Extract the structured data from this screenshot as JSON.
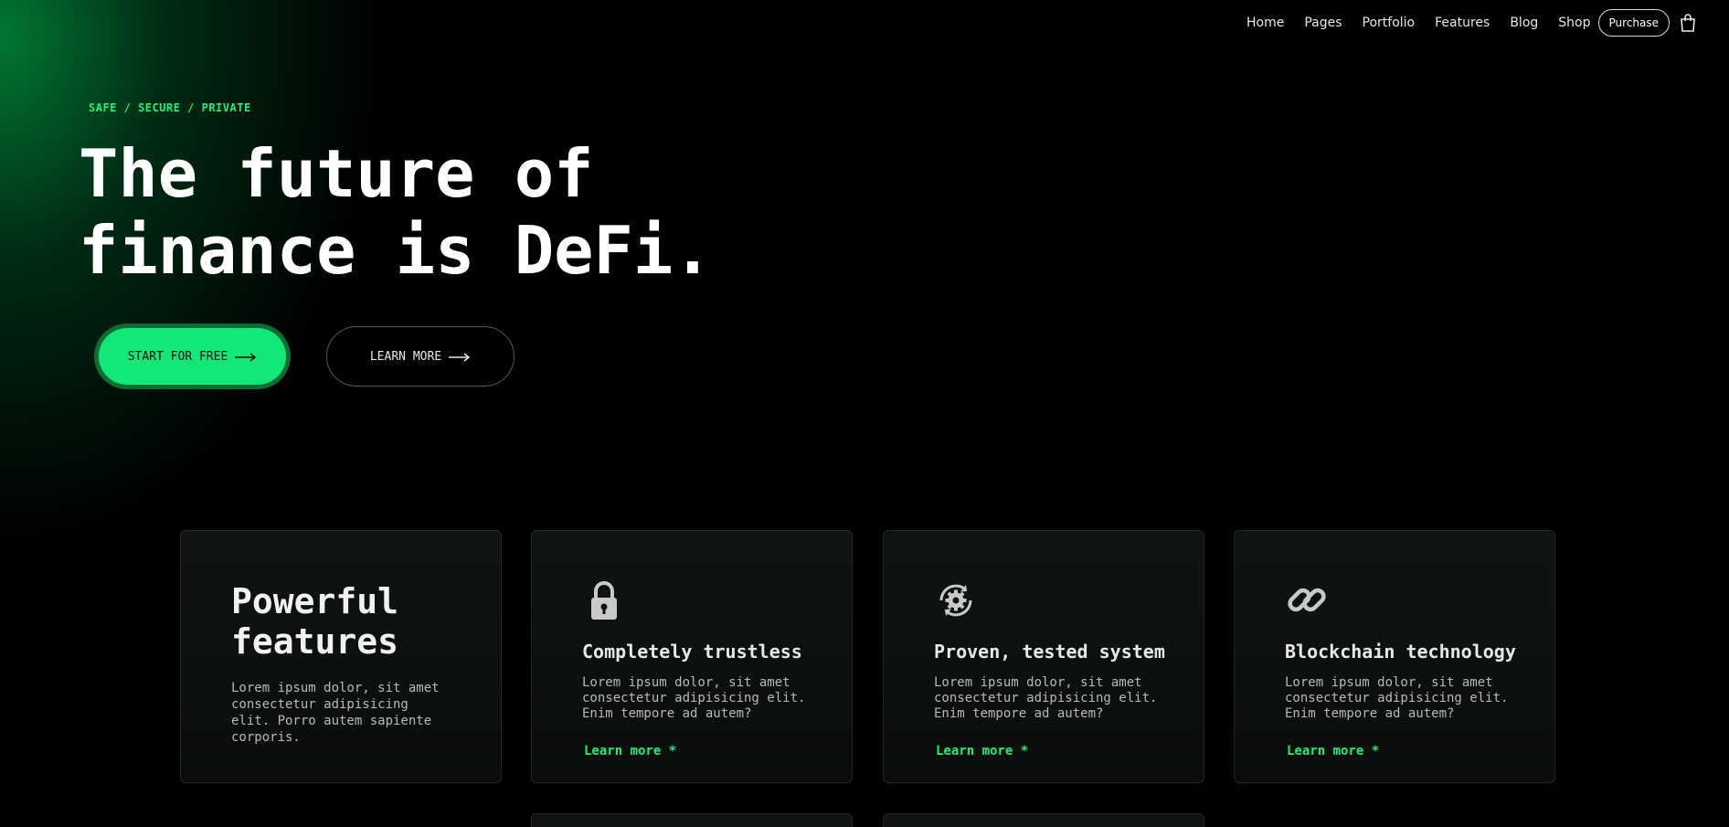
{
  "nav": {
    "links": [
      "Home",
      "Pages",
      "Portfolio",
      "Features",
      "Blog",
      "Shop"
    ],
    "purchase_label": "Purchase",
    "cart_icon": "shopping-bag-icon"
  },
  "hero": {
    "tagline": "SAFE / SECURE / PRIVATE",
    "title_line1": "The future of",
    "title_line2": "finance is DeFi.",
    "primary_button": "START FOR FREE",
    "secondary_button": "LEARN MORE"
  },
  "features": {
    "intro": {
      "title_line1": "Powerful",
      "title_line2": "features",
      "description": "Lorem ipsum dolor, sit amet consectetur adipisicing elit. Porro autem sapiente corporis."
    },
    "cards": [
      {
        "icon": "lock-icon",
        "title": "Completely trustless",
        "description": "Lorem ipsum dolor, sit amet consectetur adipisicing elit. Enim tempore ad autem?",
        "link": "Learn more *"
      },
      {
        "icon": "gear-refresh-icon",
        "title": "Proven, tested system",
        "description": "Lorem ipsum dolor, sit amet consectetur adipisicing elit. Enim tempore ad autem?",
        "link": "Learn more *"
      },
      {
        "icon": "chain-link-icon",
        "title": "Blockchain technology",
        "description": "Lorem ipsum dolor, sit amet consectetur adipisicing elit. Enim tempore ad autem?",
        "link": "Learn more *"
      }
    ]
  },
  "colors": {
    "accent": "#12e878",
    "accent_text": "#19f07a",
    "background": "#000000",
    "card_bg": "#0f1412"
  }
}
